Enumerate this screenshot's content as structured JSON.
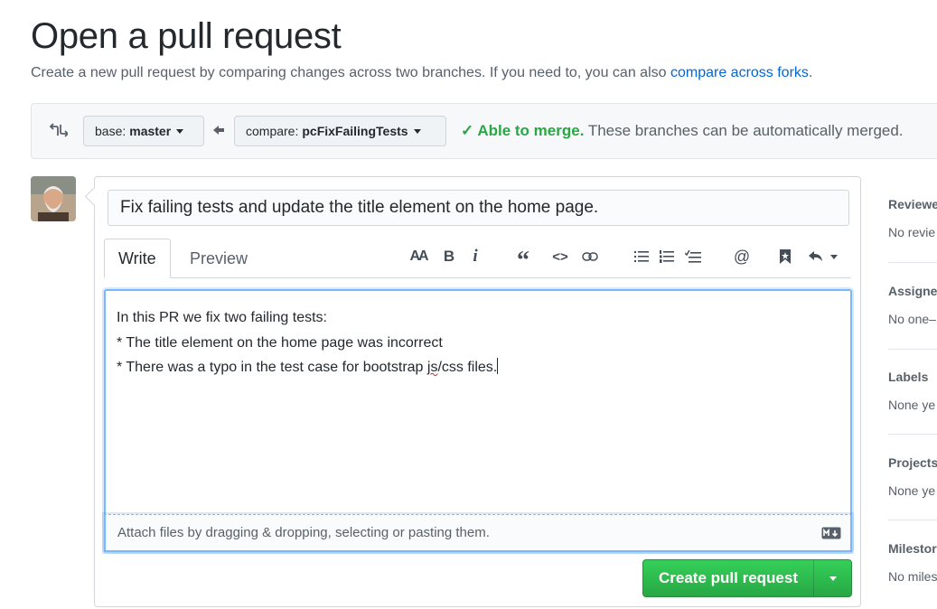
{
  "page": {
    "title": "Open a pull request",
    "subtitle_prefix": "Create a new pull request by comparing changes across two branches. If you need to, you can also ",
    "subtitle_link": "compare across forks",
    "subtitle_suffix": "."
  },
  "range": {
    "base_label": "base:",
    "base_branch": "master",
    "compare_label": "compare:",
    "compare_branch": "pcFixFailingTests",
    "merge_ok": "✓ Able to merge.",
    "merge_detail": " These branches can be automatically merged."
  },
  "form": {
    "title_value": "Fix failing tests and update the title element on the home page.",
    "tabs": {
      "write": "Write",
      "preview": "Preview"
    },
    "body_lines": [
      "In this PR we fix two failing tests:",
      "* The title element on the home page was incorrect"
    ],
    "body_line3_before": "* There was a typo in the test case for bootstrap ",
    "body_line3_typo": "js",
    "body_line3_after": "/css files.",
    "attach_text": "Attach files by dragging & dropping, selecting or pasting them.",
    "submit_label": "Create pull request"
  },
  "toolbar": {
    "text_size": "AA",
    "bold": "B",
    "italic": "i",
    "quote": "“",
    "code": "<>",
    "link_icon": "link-icon",
    "ul_icon": "unordered-list-icon",
    "ol_icon": "ordered-list-icon",
    "task_icon": "task-list-icon",
    "mention": "@",
    "saved_reply_icon": "bookmark-icon",
    "reply_icon": "reply-icon"
  },
  "sidebar": {
    "reviewers": {
      "heading": "Reviewe",
      "value": "No revie"
    },
    "assignees": {
      "heading": "Assigne",
      "value": "No one–"
    },
    "labels": {
      "heading": "Labels",
      "value": "None ye"
    },
    "projects": {
      "heading": "Projects",
      "value": "None ye"
    },
    "milestone": {
      "heading": "Milestor",
      "value": "No miles"
    }
  },
  "colors": {
    "link": "#0366d6",
    "success": "#28a745",
    "focus": "#79b8ff"
  }
}
